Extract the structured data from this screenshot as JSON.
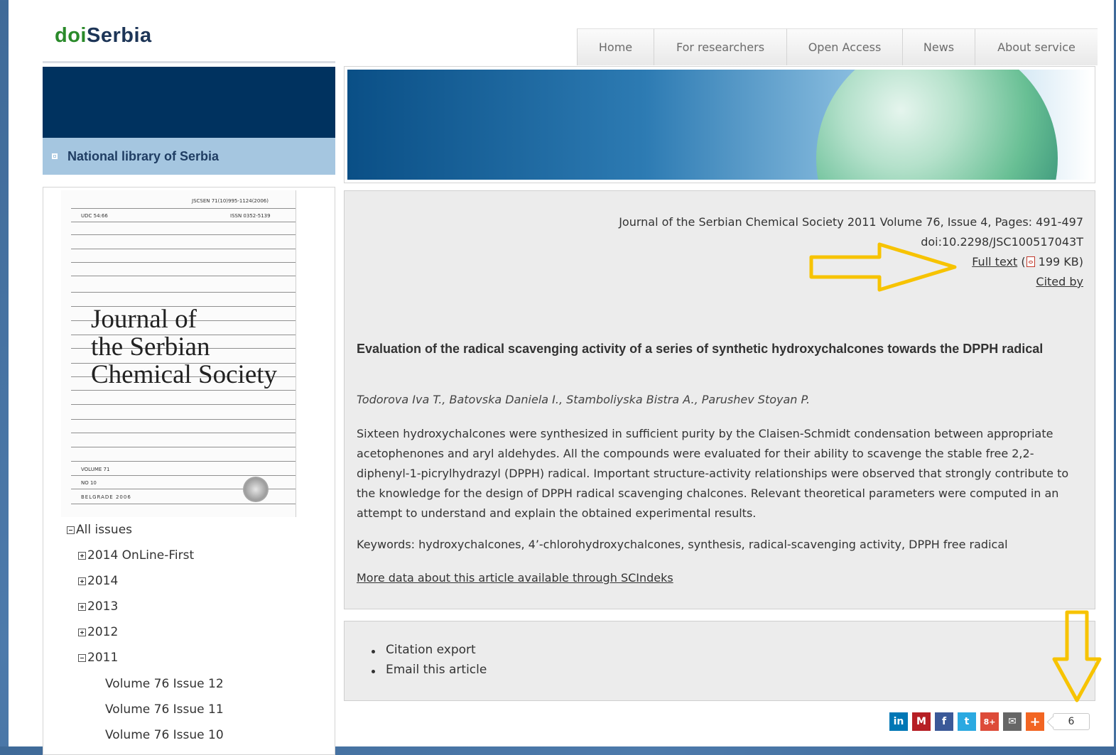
{
  "site": {
    "logo_doi": "doi",
    "logo_serbia": "Serbia"
  },
  "nav": {
    "items": [
      "Home",
      "For researchers",
      "Open Access",
      "News",
      "About service"
    ]
  },
  "sidebar": {
    "library_label": "National library of Serbia",
    "cover": {
      "code": "JSCSEN 71(10)995-1124(2006)",
      "udc": "UDC 54:66",
      "issn": "ISSN 0352-5139",
      "title_line1": "Journal of",
      "title_line2": "the Serbian",
      "title_line3": "Chemical Society",
      "volume": "VOLUME 71",
      "number": "NO 10",
      "city_year": "BELGRADE 2006"
    },
    "tree": [
      {
        "label": "All issues",
        "toggle": "minus"
      },
      {
        "label": "2014 OnLine-First",
        "toggle": "plus"
      },
      {
        "label": "2014",
        "toggle": "plus"
      },
      {
        "label": "2013",
        "toggle": "plus"
      },
      {
        "label": "2012",
        "toggle": "plus"
      },
      {
        "label": "2011",
        "toggle": "minus"
      },
      {
        "label": "Volume 76 Issue 12"
      },
      {
        "label": "Volume 76 Issue 11"
      },
      {
        "label": "Volume 76 Issue 10"
      }
    ]
  },
  "article": {
    "citation": "Journal of the Serbian Chemical Society 2011 Volume 76, Issue 4, Pages: 491-497",
    "doi": "doi:10.2298/JSC100517043T",
    "full_text_label": "Full text",
    "open_paren": " (",
    "file_size": " 199 KB)",
    "cited_by_label": "Cited by",
    "title": "Evaluation of the radical scavenging activity of a series of synthetic hydroxychalcones towards the DPPH radical",
    "authors": "Todorova Iva T., Batovska Daniela I., Stamboliyska Bistra A., Parushev Stoyan P.",
    "abstract": "Sixteen hydroxychalcones were synthesized in sufficient purity by the Claisen-Schmidt condensation between appropriate acetophenones and aryl aldehydes. All the compounds were evaluated for their ability to scavenge the stable free 2,2-diphenyl-1-picrylhydrazyl (DPPH) radical. Important structure-activity relationships were observed that strongly contribute to the knowledge for the design of DPPH radical scavenging chalcones. Relevant theoretical parameters were computed in an attempt to understand and explain the obtained experimental results.",
    "keywords": "Keywords: hydroxychalcones, 4’-chlorohydroxychalcones, synthesis, radical-scavenging activity, DPPH free radical",
    "more_link": "More data about this article available through SCIndeks"
  },
  "tools": {
    "citation_export": "Citation export",
    "email_article": "Email this article"
  },
  "share": {
    "buttons": [
      {
        "icon": "linkedin-icon",
        "glyph": "in",
        "color": "#0077b5"
      },
      {
        "icon": "mendeley-icon",
        "glyph": "M",
        "color": "#b61f24"
      },
      {
        "icon": "facebook-icon",
        "glyph": "f",
        "color": "#3b5998"
      },
      {
        "icon": "twitter-icon",
        "glyph": "t",
        "color": "#2ba9e1"
      },
      {
        "icon": "google-plus-icon",
        "glyph": "8+",
        "color": "#dd4b39"
      },
      {
        "icon": "email-icon",
        "glyph": "✉",
        "color": "#666666"
      },
      {
        "icon": "add-more-icon",
        "glyph": "+",
        "color": "#f26522"
      }
    ],
    "count": "6"
  },
  "colors": {
    "annotation": "#f7c300",
    "navy": "#00325f",
    "library_bar": "#a5c6e0",
    "panel": "#ececec"
  }
}
